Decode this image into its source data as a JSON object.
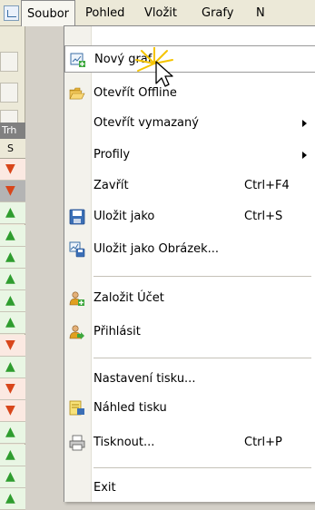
{
  "menubar": {
    "items": [
      {
        "label": "Soubor"
      },
      {
        "label": "Pohled"
      },
      {
        "label": "Vložit"
      },
      {
        "label": "Grafy"
      },
      {
        "label": "N"
      }
    ]
  },
  "background": {
    "tab_header": "Trh",
    "column_header": "S",
    "rows": [
      {
        "direction": "down"
      },
      {
        "direction": "down"
      },
      {
        "direction": "up"
      },
      {
        "direction": "up"
      },
      {
        "direction": "up"
      },
      {
        "direction": "up"
      },
      {
        "direction": "up"
      },
      {
        "direction": "up"
      },
      {
        "direction": "down"
      },
      {
        "direction": "up"
      },
      {
        "direction": "down"
      },
      {
        "direction": "down"
      },
      {
        "direction": "up"
      },
      {
        "direction": "up"
      },
      {
        "direction": "up"
      },
      {
        "direction": "up"
      }
    ]
  },
  "file_menu": {
    "items": [
      {
        "label": "Nový graf",
        "icon": "new-chart-icon",
        "highlighted": true
      },
      {
        "label": "Otevřít Offline",
        "icon": "open-folder-icon"
      },
      {
        "label": "Otevřít vymazaný",
        "submenu": true
      },
      {
        "label": "Profily",
        "submenu": true
      },
      {
        "label": "Zavřít",
        "shortcut": "Ctrl+F4"
      },
      {
        "label": "Uložit jako",
        "icon": "save-icon",
        "shortcut": "Ctrl+S"
      },
      {
        "label": "Uložit jako Obrázek...",
        "icon": "save-picture-icon"
      },
      {
        "label": "Založit Účet",
        "icon": "new-account-icon"
      },
      {
        "label": "Přihlásit",
        "icon": "login-icon"
      },
      {
        "label": "Nastavení tisku..."
      },
      {
        "label": "Náhled tisku",
        "icon": "print-preview-icon"
      },
      {
        "label": "Tisknout...",
        "icon": "printer-icon",
        "shortcut": "Ctrl+P"
      },
      {
        "label": "Exit"
      }
    ]
  },
  "colors": {
    "up_arrow": "#2f9d2f",
    "down_arrow": "#d8461b",
    "menu_gutter": "#f3f2ec",
    "menubar": "#ece9d8"
  }
}
